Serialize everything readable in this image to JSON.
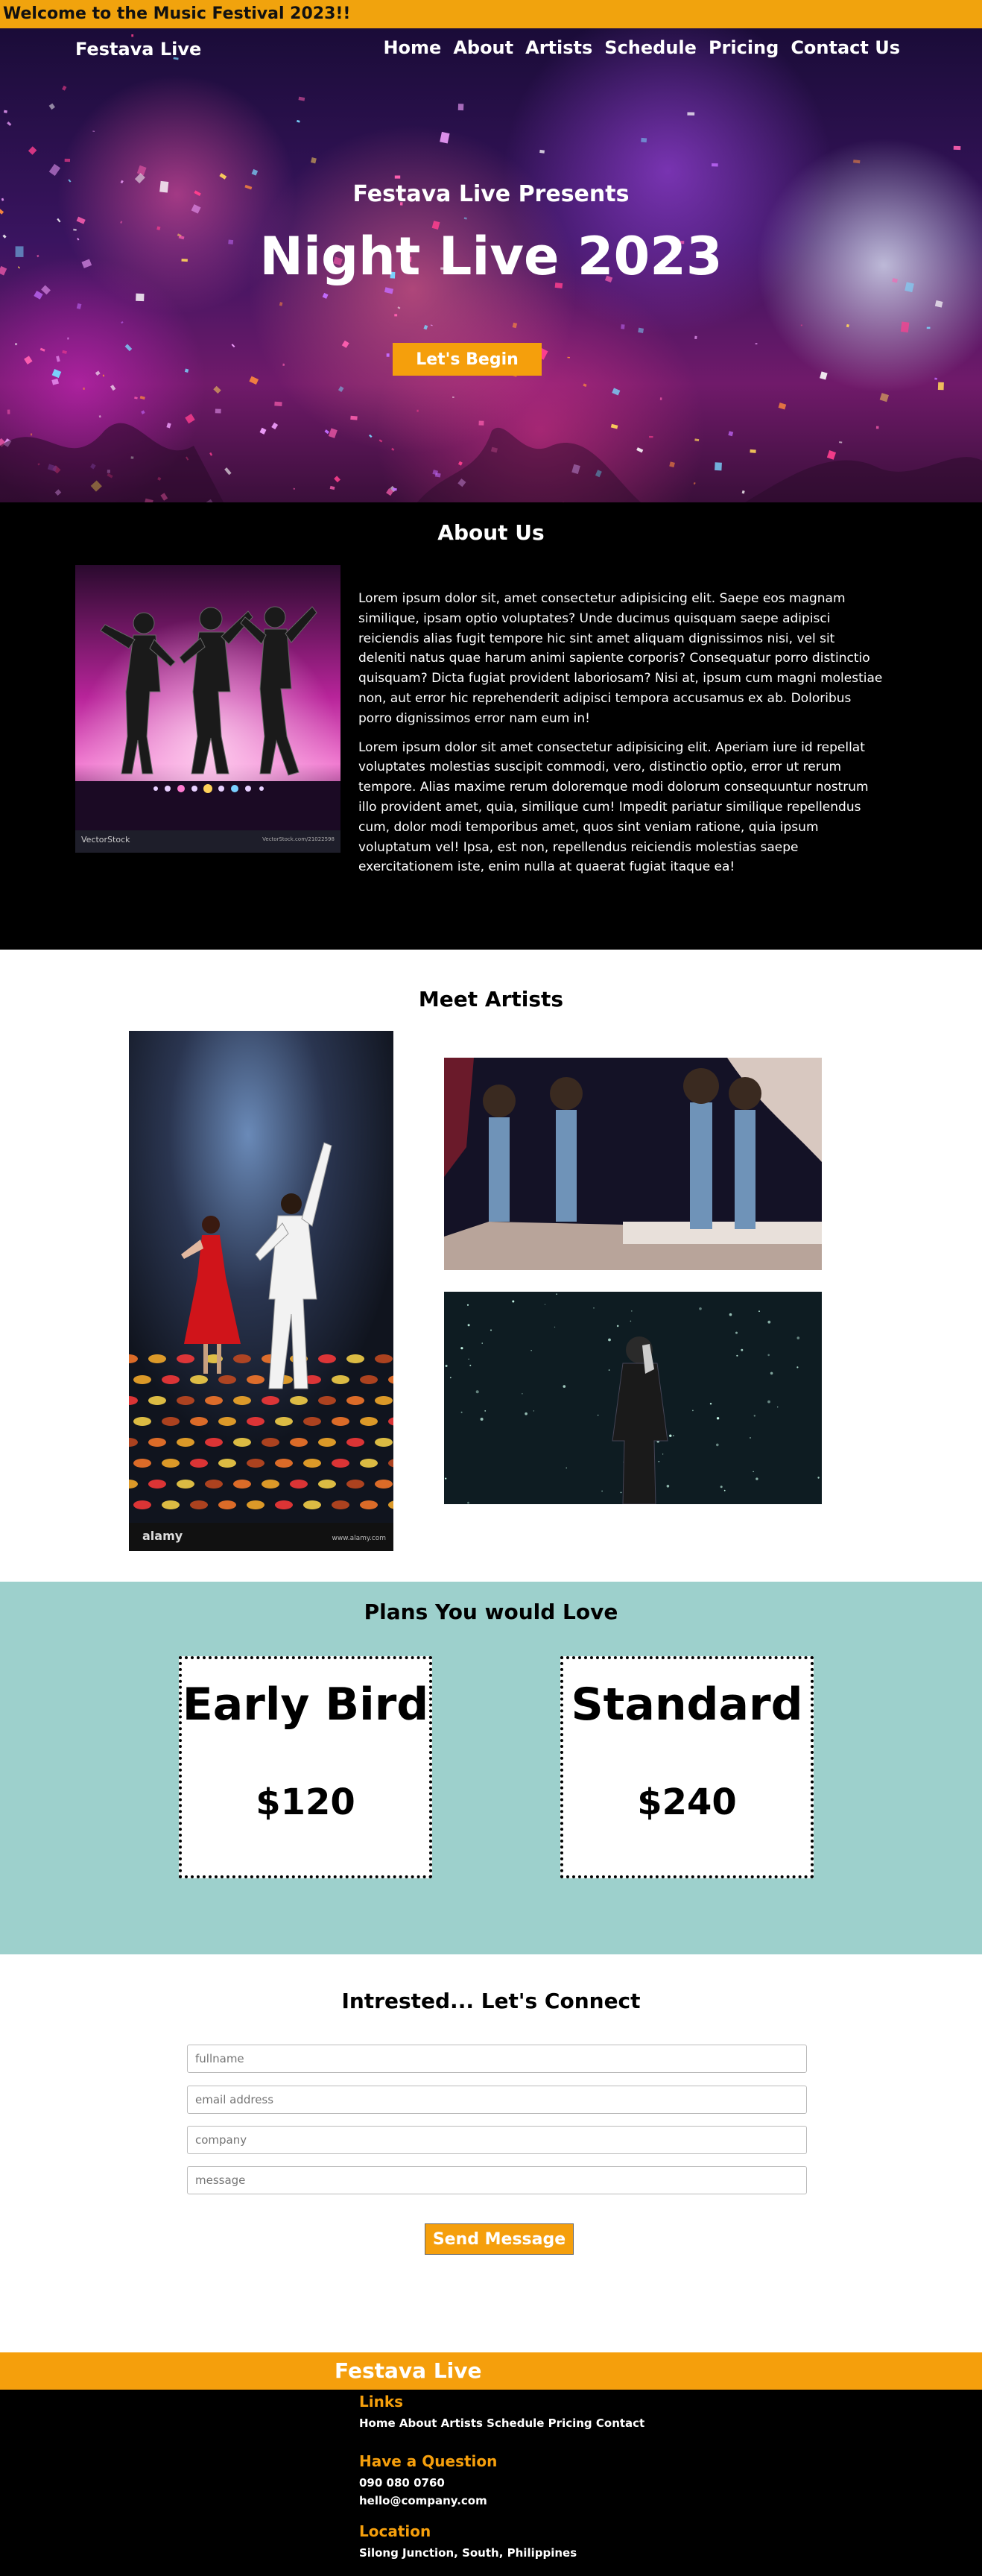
{
  "topbar": {
    "welcome": "Welcome to the Music Festival 2023!!"
  },
  "header": {
    "brand": "Festava Live",
    "nav": [
      "Home",
      "About",
      "Artists",
      "Schedule",
      "Pricing",
      "Contact Us"
    ]
  },
  "hero": {
    "subtitle": "Festava Live Presents",
    "title": "Night Live 2023",
    "cta": "Let's Begin"
  },
  "about": {
    "title": "About Us",
    "image_credit_left": "VectorStock",
    "image_credit_right": "VectorStock.com/21022598",
    "paragraph1": "Lorem ipsum dolor sit, amet consectetur adipisicing elit. Saepe eos magnam similique, ipsam optio voluptates? Unde ducimus quisquam saepe adipisci reiciendis alias fugit tempore hic sint amet aliquam dignissimos nisi, vel sit deleniti natus quae harum animi sapiente corporis? Consequatur porro distinctio quisquam? Dicta fugiat provident laboriosam? Nisi at, ipsum cum magni molestiae non, aut error hic reprehenderit adipisci tempora accusamus ex ab. Doloribus porro dignissimos error nam eum in!",
    "paragraph2": "Lorem ipsum dolor sit amet consectetur adipisicing elit. Aperiam iure id repellat voluptates molestias suscipit commodi, vero, distinctio optio, error ut rerum tempore. Alias maxime rerum doloremque modi dolorum consequuntur nostrum illo provident amet, quia, similique cum! Impedit pariatur similique repellendus cum, dolor modi temporibus amet, quos sint veniam ratione, quia ipsum voluptatum vel! Ipsa, est non, repellendus reiciendis molestias saepe exercitationem iste, enim nulla at quaerat fugiat itaque ea!"
  },
  "artists": {
    "title": "Meet Artists",
    "watermark": "alamy",
    "watermark_url": "www.alamy.com"
  },
  "plans": {
    "title": "Plans You would Love",
    "items": [
      {
        "name": "Early Bird",
        "price": "$120"
      },
      {
        "name": "Standard",
        "price": "$240"
      }
    ]
  },
  "contact": {
    "title": "Intrested... Let's Connect",
    "placeholders": {
      "fullname": "fullname",
      "email": "email address",
      "company": "company",
      "message": "message"
    },
    "send": "Send Message"
  },
  "footer": {
    "brand": "Festava Live",
    "links_title": "Links",
    "links": "Home About Artists Schedule Pricing Contact",
    "question_title": "Have a Question",
    "phone": "090 080 0760",
    "email": "hello@company.com",
    "location_title": "Location",
    "location": "Silong Junction, South, Philippines"
  },
  "colors": {
    "accent": "#f59f0c",
    "topbar": "#f1a30d",
    "plans_bg": "#9dd0cc",
    "dark_bg": "#000000"
  }
}
